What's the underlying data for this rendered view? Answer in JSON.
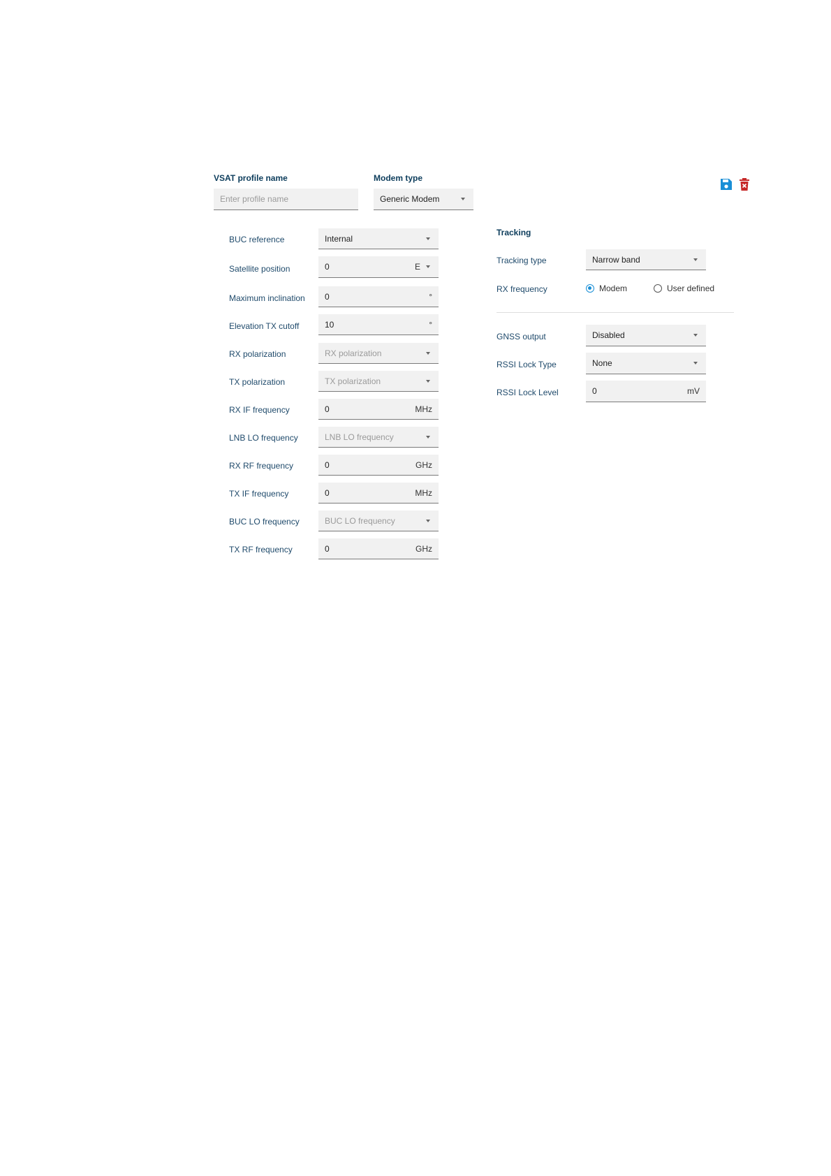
{
  "header": {
    "profile_name_label": "VSAT profile name",
    "profile_name_placeholder": "Enter profile name",
    "modem_type_label": "Modem type",
    "modem_type_value": "Generic Modem"
  },
  "actions": {
    "save_icon": "floppy-disk-icon",
    "delete_icon": "trash-icon",
    "save_color": "#1a8fd6",
    "delete_color": "#c62828"
  },
  "left": {
    "buc_reference": {
      "label": "BUC reference",
      "value": "Internal"
    },
    "satellite_position": {
      "label": "Satellite position",
      "value": "0",
      "unit": "E"
    },
    "maximum_inclination": {
      "label": "Maximum inclination",
      "value": "0",
      "unit": "°"
    },
    "elevation_tx_cutoff": {
      "label": "Elevation TX cutoff",
      "value": "10",
      "unit": "°"
    },
    "rx_polarization": {
      "label": "RX polarization",
      "placeholder": "RX polarization"
    },
    "tx_polarization": {
      "label": "TX polarization",
      "placeholder": "TX polarization"
    },
    "rx_if_frequency": {
      "label": "RX IF frequency",
      "value": "0",
      "unit": "MHz"
    },
    "lnb_lo_frequency": {
      "label": "LNB LO frequency",
      "placeholder": "LNB LO frequency"
    },
    "rx_rf_frequency": {
      "label": "RX RF frequency",
      "value": "0",
      "unit": "GHz"
    },
    "tx_if_frequency": {
      "label": "TX IF frequency",
      "value": "0",
      "unit": "MHz"
    },
    "buc_lo_frequency": {
      "label": "BUC LO frequency",
      "placeholder": "BUC LO frequency"
    },
    "tx_rf_frequency": {
      "label": "TX RF frequency",
      "value": "0",
      "unit": "GHz"
    }
  },
  "tracking": {
    "title": "Tracking",
    "tracking_type": {
      "label": "Tracking type",
      "value": "Narrow band"
    },
    "rx_frequency": {
      "label": "RX frequency",
      "option_modem": "Modem",
      "option_user": "User defined",
      "selected": "Modem"
    },
    "gnss_output": {
      "label": "GNSS output",
      "value": "Disabled"
    },
    "rssi_lock_type": {
      "label": "RSSI Lock Type",
      "value": "None"
    },
    "rssi_lock_level": {
      "label": "RSSI Lock Level",
      "value": "0",
      "unit": "mV"
    }
  }
}
